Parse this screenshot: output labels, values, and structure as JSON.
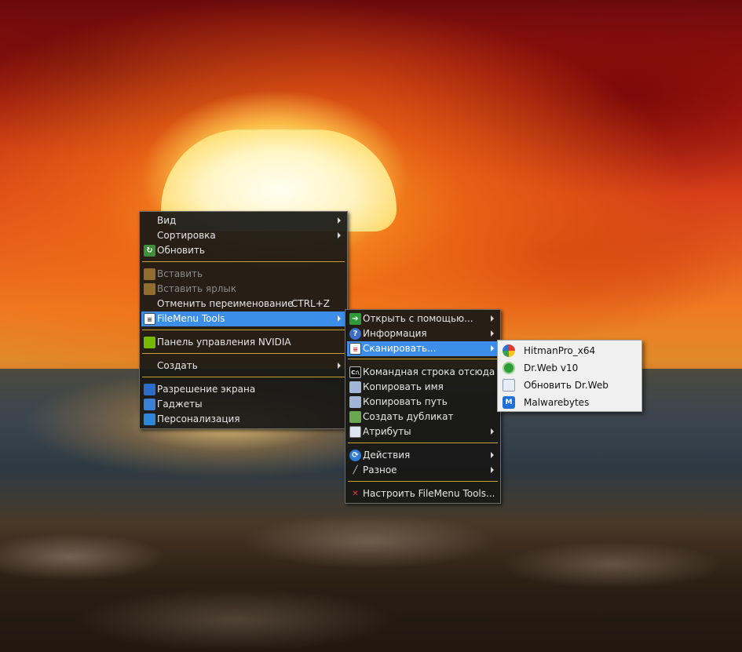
{
  "desktop_menu": {
    "items": [
      {
        "label": "Вид",
        "submenu": true
      },
      {
        "label": "Сортировка",
        "submenu": true
      },
      {
        "label": "Обновить",
        "icon": "refresh-icon"
      },
      {
        "label": "Вставить",
        "disabled": true,
        "icon": "paste-icon"
      },
      {
        "label": "Вставить ярлык",
        "disabled": true,
        "icon": "paste-shortcut-icon"
      },
      {
        "label": "Отменить переименование",
        "shortcut": "CTRL+Z"
      },
      {
        "label": "FileMenu Tools",
        "submenu": true,
        "selected": true,
        "icon": "filemenu-tools-icon"
      },
      {
        "label": "Панель управления NVIDIA",
        "icon": "nvidia-icon"
      },
      {
        "label": "Создать",
        "submenu": true
      },
      {
        "label": "Разрешение экрана",
        "icon": "display-icon"
      },
      {
        "label": "Гаджеты",
        "icon": "gadgets-icon"
      },
      {
        "label": "Персонализация",
        "icon": "personalization-icon"
      }
    ]
  },
  "filemenu_submenu": {
    "items": [
      {
        "label": "Открыть с помощью...",
        "submenu": true,
        "icon": "open-with-icon"
      },
      {
        "label": "Информация",
        "submenu": true,
        "icon": "info-icon"
      },
      {
        "label": "Сканировать...",
        "submenu": true,
        "selected": true,
        "icon": "scan-icon"
      },
      {
        "label": "Командная строка отсюда",
        "icon": "cmd-icon"
      },
      {
        "label": "Копировать имя",
        "icon": "copy-name-icon"
      },
      {
        "label": "Копировать путь",
        "icon": "copy-path-icon"
      },
      {
        "label": "Создать дубликат",
        "icon": "duplicate-icon"
      },
      {
        "label": "Атрибуты",
        "submenu": true,
        "icon": "attributes-icon"
      },
      {
        "label": "Действия",
        "submenu": true,
        "icon": "actions-icon"
      },
      {
        "label": "Разное",
        "submenu": true,
        "icon": "misc-icon"
      },
      {
        "label": "Настроить FileMenu Tools...",
        "icon": "settings-tools-icon"
      }
    ]
  },
  "scan_submenu": {
    "items": [
      {
        "label": "HitmanPro_x64",
        "icon": "hitmanpro-icon"
      },
      {
        "label": "Dr.Web v10",
        "icon": "drweb-icon"
      },
      {
        "label": "Обновить Dr.Web",
        "icon": "drweb-update-icon"
      },
      {
        "label": "Malwarebytes",
        "icon": "malwarebytes-icon"
      }
    ]
  },
  "colors": {
    "menu_background": "#181816",
    "highlight": "#3d8ee8",
    "separator": "#c9a12a",
    "submenu_background": "#f0f0f0"
  }
}
